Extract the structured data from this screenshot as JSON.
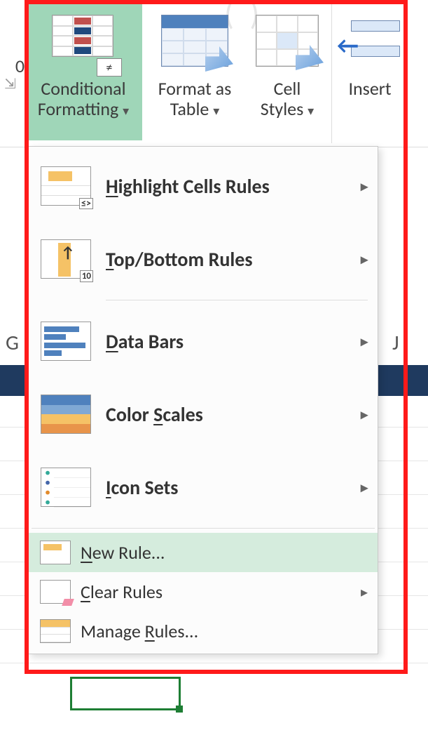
{
  "ribbon": {
    "leftStub": {
      "top": "0",
      "sub": "⇲"
    },
    "conditionalFormatting": {
      "line1": "Conditional",
      "line2": "Formatting"
    },
    "formatAsTable": {
      "line1": "Format as",
      "line2": "Table"
    },
    "cellStyles": {
      "line1": "Cell",
      "line2": "Styles"
    },
    "insert": {
      "line1": "Insert"
    }
  },
  "menu": {
    "highlightCells": "Highlight Cells Rules",
    "topBottom": "Top/Bottom Rules",
    "dataBars": "Data Bars",
    "colorScales": "Color Scales",
    "iconSets": "Icon Sets",
    "newRule": "New Rule...",
    "clearRules": "Clear Rules",
    "manageRules": "Manage Rules..."
  },
  "columns": {
    "g": "G",
    "j": "J"
  }
}
